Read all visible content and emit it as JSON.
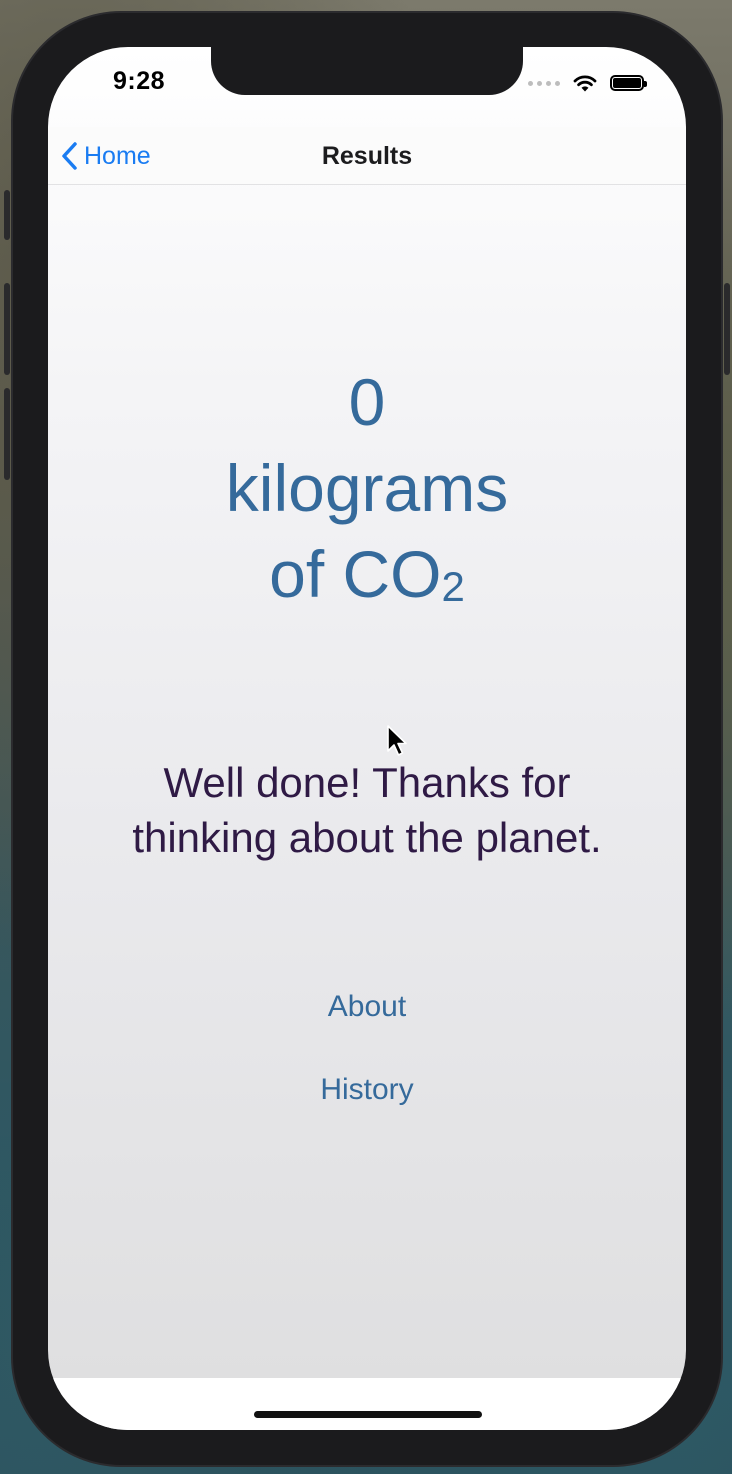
{
  "status_bar": {
    "time": "9:28"
  },
  "nav": {
    "back_label": "Home",
    "title": "Results"
  },
  "result": {
    "value": "0",
    "unit": "kilograms",
    "of_label": "of CO",
    "subscript": "2"
  },
  "message": {
    "line1": "Well done! Thanks for",
    "line2": "thinking about the planet."
  },
  "links": {
    "about": "About",
    "history": "History"
  },
  "colors": {
    "accent_blue": "#1a7cf2",
    "result_blue": "#356a9b",
    "message_purple": "#2f1a45"
  }
}
